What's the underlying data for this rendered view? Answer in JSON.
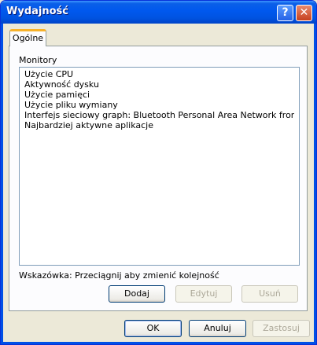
{
  "window": {
    "title": "Wydajność",
    "help_glyph": "?",
    "close_glyph": "✕"
  },
  "tabs": [
    {
      "label": "Ogólne",
      "active": true
    }
  ],
  "monitors": {
    "label": "Monitory",
    "items": [
      "Użycie CPU",
      "Aktywność dysku",
      "Użycie pamięci",
      "Użycie pliku wymiany",
      "Interfejs sieciowy graph: Bluetooth Personal Area Network from TOS...",
      "Najbardziej aktywne aplikacje"
    ]
  },
  "hint": "Wskazówka: Przeciągnij aby zmienić kolejność",
  "list_buttons": {
    "add": "Dodaj",
    "edit": "Edytuj",
    "remove": "Usuń"
  },
  "dialog_buttons": {
    "ok": "OK",
    "cancel": "Anuluj",
    "apply": "Zastosuj"
  }
}
